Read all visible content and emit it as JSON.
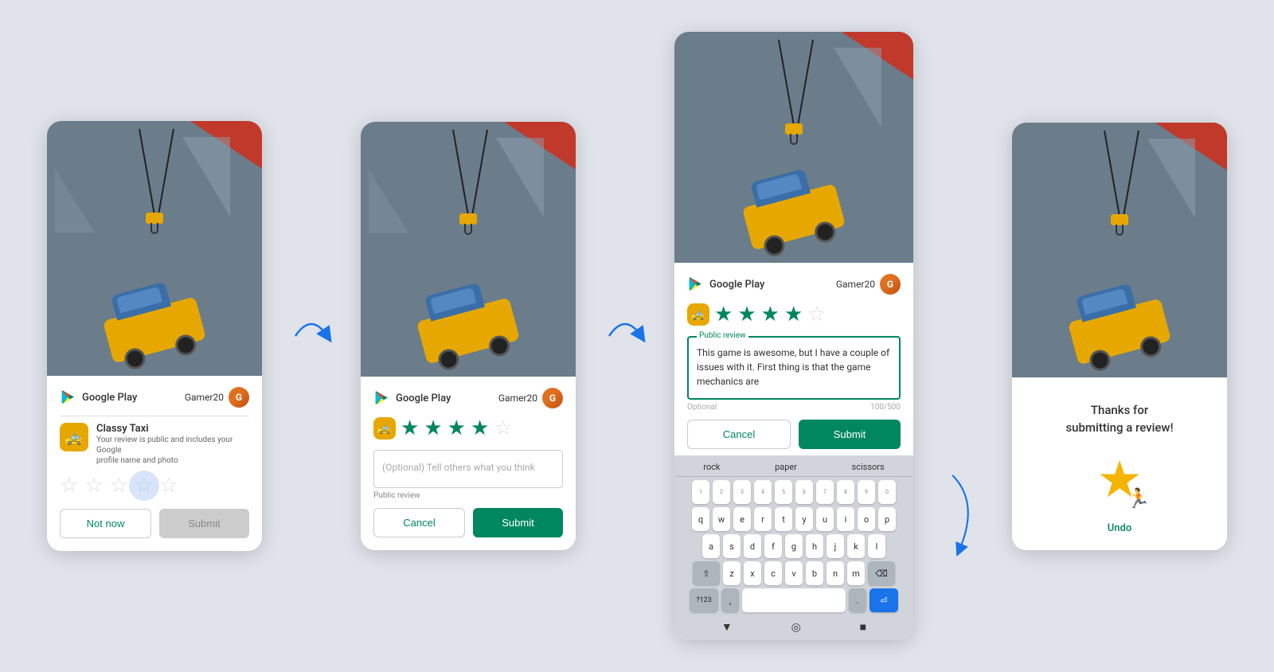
{
  "screens": [
    {
      "id": "screen1",
      "header": {
        "logo_text": "Google Play",
        "username": "Gamer20"
      },
      "app": {
        "name": "Classy Taxi",
        "subtitle": "Your review is public and includes your Google\nprofile name and photo"
      },
      "stars": [
        false,
        false,
        false,
        false,
        false
      ],
      "buttons": {
        "not_now": "Not now",
        "submit": "Submit"
      }
    },
    {
      "id": "screen2",
      "header": {
        "logo_text": "Google Play",
        "username": "Gamer20"
      },
      "stars": [
        true,
        true,
        true,
        true,
        false
      ],
      "review_placeholder": "(Optional) Tell others what you think",
      "review_label": "Public review",
      "buttons": {
        "cancel": "Cancel",
        "submit": "Submit"
      }
    },
    {
      "id": "screen3",
      "header": {
        "logo_text": "Google Play",
        "username": "Gamer20"
      },
      "stars": [
        true,
        true,
        true,
        true,
        false
      ],
      "review_text": "This game is awesome, but I have a couple of issues with it. First thing is that the game mechanics are",
      "review_label": "Public review",
      "review_optional": "Optional",
      "review_count": "100/500",
      "buttons": {
        "cancel": "Cancel",
        "submit": "Submit"
      },
      "keyboard": {
        "suggestions": [
          "rock",
          "paper",
          "scissors"
        ],
        "rows": [
          [
            "q",
            "w",
            "e",
            "r",
            "t",
            "y",
            "u",
            "i",
            "o",
            "p"
          ],
          [
            "a",
            "s",
            "d",
            "f",
            "g",
            "h",
            "j",
            "k",
            "l"
          ],
          [
            "z",
            "x",
            "c",
            "v",
            "b",
            "n",
            "m"
          ],
          [
            "?123",
            ",",
            ".",
            "⏎"
          ]
        ]
      }
    },
    {
      "id": "screen4",
      "thanks_text": "Thanks for\nsubmitting a review!",
      "undo_label": "Undo"
    }
  ],
  "arrows": [
    {
      "id": "arrow1",
      "from": "screen1",
      "to": "screen2"
    },
    {
      "id": "arrow2",
      "from": "screen2",
      "to": "screen3"
    },
    {
      "id": "arrow3",
      "from": "screen3",
      "to": "screen4"
    }
  ]
}
